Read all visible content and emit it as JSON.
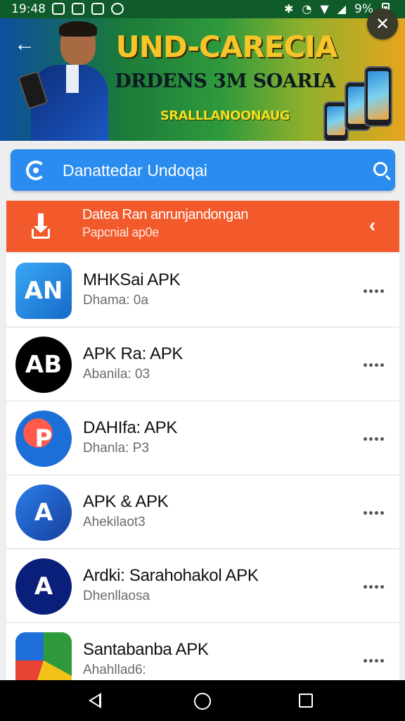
{
  "status_bar": {
    "time": "19:48",
    "battery_text": "9%"
  },
  "banner": {
    "title": "UND-CARECIA",
    "subtitle": "DRDENS 3M SOARIA",
    "tagline": "SRALLLANOONAUG",
    "back_icon": "arrow-left-icon",
    "close_icon": "close-icon"
  },
  "search": {
    "placeholder": "Danattedar Undoqai",
    "leading_icon": "lifebuoy-icon",
    "trailing_icon": "search-icon",
    "color": "#2b8cf0"
  },
  "section_header": {
    "title": "Datea Ran anrunjandongan",
    "subtitle": "Papcnial ap0e",
    "icon": "download-icon",
    "chevron_icon": "chevron-left-icon",
    "color": "#f25a2b"
  },
  "apps": [
    {
      "name": "MHKSai APK",
      "subtitle": "Dhama: 0a",
      "icon_text": "AN",
      "icon_bg": "#1e8be6"
    },
    {
      "name": "APK Ra: APK",
      "subtitle": "Abanila: 03",
      "icon_text": "AB",
      "icon_bg": "#000000"
    },
    {
      "name": "DAHIfa: APK",
      "subtitle": "Dhanla: P3",
      "icon_text": "P",
      "icon_bg": "#1d6fd8"
    },
    {
      "name": "APK & APK",
      "subtitle": "Ahekilaot3",
      "icon_text": "A",
      "icon_bg": "#1a56c4"
    },
    {
      "name": "Ardki: Sarahohakol APK",
      "subtitle": "Dhenllaosa",
      "icon_text": "A",
      "icon_bg": "#0a1f7a"
    },
    {
      "name": "Santabanba APK",
      "subtitle": "Ahahllad6:",
      "icon_text": "",
      "icon_bg": "#2f9a3c"
    }
  ]
}
